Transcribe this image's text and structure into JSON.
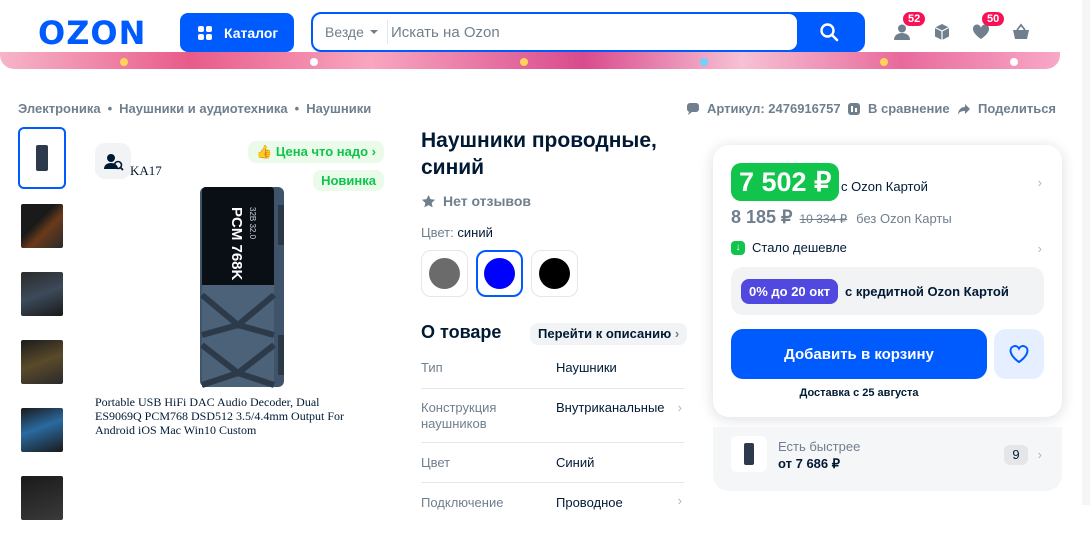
{
  "header": {
    "logo": "OZON",
    "catalog_label": "Каталог",
    "search_scope": "Везде",
    "search_placeholder": "Искать на Ozon",
    "profile_badge": "52",
    "favorites_badge": "50"
  },
  "breadcrumbs": [
    "Электроника",
    "Наушники и аудиотехника",
    "Наушники"
  ],
  "breadcrumb_sep": "•",
  "top_actions": {
    "article": "Артикул: 2476916757",
    "compare": "В сравнение",
    "share": "Поделиться"
  },
  "gallery": {
    "seller_tag": "KA17",
    "price_tag": "Цена что надо",
    "new_tag": "Новинка",
    "caption": "Portable USB HiFi DAC Audio Decoder, Dual ES9069Q PCM768 DSD512 3.5/4.4mm Output For Android iOS Mac Win10 Custom",
    "device_text_1": "PCM 768K",
    "device_text_2": "32B 32.0"
  },
  "product": {
    "title": "Наушники проводные, синий",
    "reviews": "Нет отзывов",
    "color_label": "Цвет:",
    "color_value": "синий",
    "swatches": [
      "#6b6b6b",
      "#0000ff",
      "#000000"
    ]
  },
  "about": {
    "title": "О товаре",
    "go_to_description": "Перейти к описанию",
    "specs": [
      {
        "key": "Тип",
        "value": "Наушники"
      },
      {
        "key": "Конструкция наушников",
        "value": "Внутриканальные"
      },
      {
        "key": "Цвет",
        "value": "Синий"
      },
      {
        "key": "Подключение",
        "value": "Проводное"
      }
    ]
  },
  "buy": {
    "price_card": "7 502 ₽",
    "with_card": "с Ozon Картой",
    "price": "8 185 ₽",
    "old_price": "10 334 ₽",
    "without_card": "без Ozon Карты",
    "cheaper": "Стало дешевле",
    "credit_pill": "0% до 20 окт",
    "credit_text": "с кредитной Ozon Картой",
    "add_to_cart": "Добавить в корзину",
    "delivery": "Доставка с 25 августа"
  },
  "faster": {
    "label": "Есть быстрее",
    "price": "от 7 686 ₽",
    "count": "9"
  },
  "colors": {
    "brand": "#005bff",
    "green": "#10c44c",
    "credit": "#5048df",
    "badge": "#f91155"
  }
}
